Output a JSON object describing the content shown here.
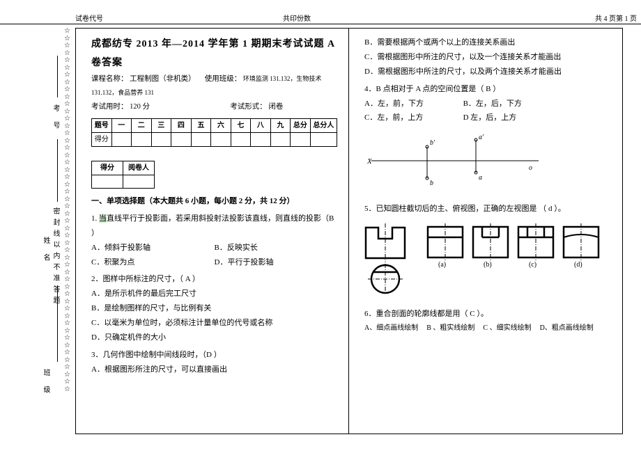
{
  "header": {
    "left": "试卷代号",
    "mid": "共印份数",
    "right_prefix": "共",
    "right_total": "4",
    "right_mid": "页第",
    "right_page": "1",
    "right_suffix": "页"
  },
  "vertical": {
    "kaohao": "考   号",
    "xingming": "姓   名",
    "banji": "班  级",
    "seal": "密封线以内不准答题"
  },
  "title": "成都纺专 2013   年—2014    学年第  1 期期末考试试题 A   卷答案",
  "course_label": "课程名称：",
  "course_name": "工程制图（非机类）",
  "class_label": "使用班级：",
  "class_value": "环境监测 131.132，生物技术 131.132，食品营养 131",
  "time_label": "考试用时：",
  "time_value": "120 分",
  "form_label": "考试形式：",
  "form_value": "闭卷",
  "score_headers": [
    "题号",
    "一",
    "二",
    "三",
    "四",
    "五",
    "六",
    "七",
    "八",
    "九",
    "总分",
    "总分人"
  ],
  "score_row2_label": "得分",
  "grader_headers": [
    "得分",
    "阅卷人"
  ],
  "section1_title": "一、单项选择题（本大题共 6 小题，每小题 2 分，共 12 分）",
  "q1": {
    "stem_a": "1.  ",
    "stem_hl": "当",
    "stem_b": "直线平行于投影面，若采用斜投射法投影该直线，则直线的投影（B     ）",
    "A": "A．倾斜于投影轴",
    "B": "B．反映实长",
    "C": "C．积聚为点",
    "D": "D．平行于投影轴"
  },
  "q2": {
    "stem": "2．图样中所标注的尺寸，（   A   ）",
    "A": "A．是所示机件的最后完工尺寸",
    "B": "B．是绘制图样的尺寸，与比例有关",
    "C": "C．以毫米为单位时，必须标注计量单位的代号或名称",
    "D": "D．只确定机件的大小"
  },
  "q3": {
    "stem": "3．几何作图中绘制中间线段时，（D     ）",
    "A": "A．根据图形所注的尺寸，可以直接画出"
  },
  "right_top": {
    "B": "B．需要根据两个或两个以上的连接关系画出",
    "C": "C．需根据图形中所注的尺寸，以及一个连接关系才能画出",
    "D": "D．需根据图形中所注的尺寸，以及两个连接关系才能画出"
  },
  "q4": {
    "stem": "4．B 点相对于 A 点的空间位置是（   B   ）",
    "A": "A．左，前，下方",
    "B": "B．左，后，下方",
    "C": "C．左，前，上方",
    "D": "D 左，后，上方"
  },
  "fig_labels": {
    "b1": "b'",
    "a1": "a'",
    "x": "X",
    "b": "b",
    "a": "a",
    "o": "o"
  },
  "q5": {
    "stem": "5．已知圆柱截切后的主、俯视图，正确的左视图是  （   d  ）。",
    "opts": [
      "(a)",
      "(b)",
      "(c)",
      "(d)"
    ]
  },
  "q6": {
    "stem": "6．重合剖面的轮廓线都是用（   C   ）。",
    "A": "A、细点画线绘制",
    "B": "B 、粗实线绘制",
    "C": "C 、细实线绘制",
    "D": "D、粗点画线绘制"
  }
}
